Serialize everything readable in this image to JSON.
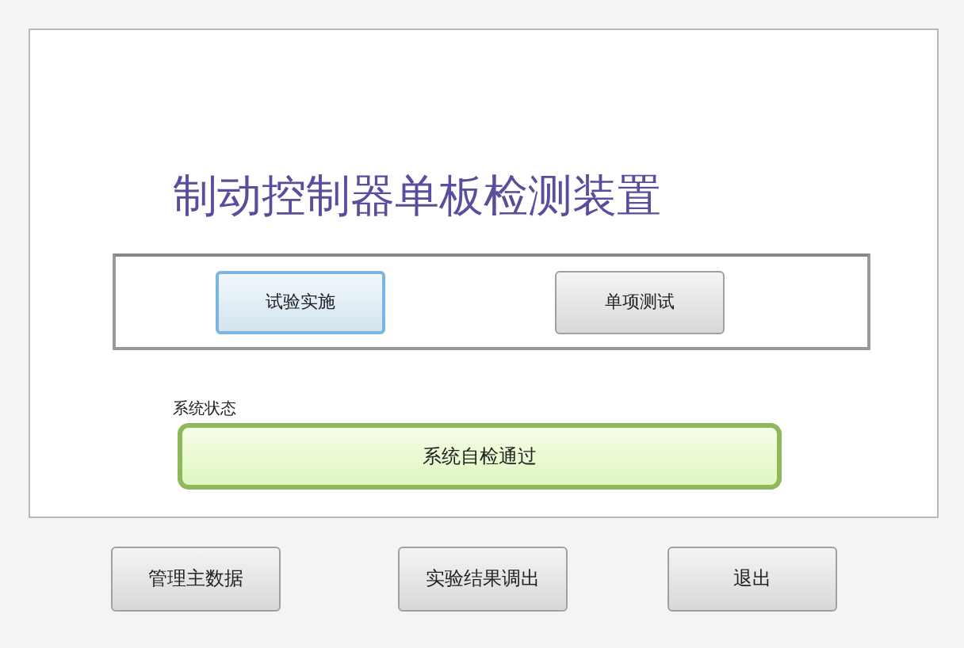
{
  "title": "制动控制器单板检测装置",
  "test_buttons": [
    {
      "label": "试验实施",
      "focused": true
    },
    {
      "label": "单项测试",
      "focused": false
    }
  ],
  "status": {
    "label": "系统状态",
    "text": "系统自检通过",
    "kind": "ok"
  },
  "bottom_buttons": [
    {
      "label": "管理主数据"
    },
    {
      "label": "实验结果调出"
    },
    {
      "label": "退出"
    }
  ]
}
